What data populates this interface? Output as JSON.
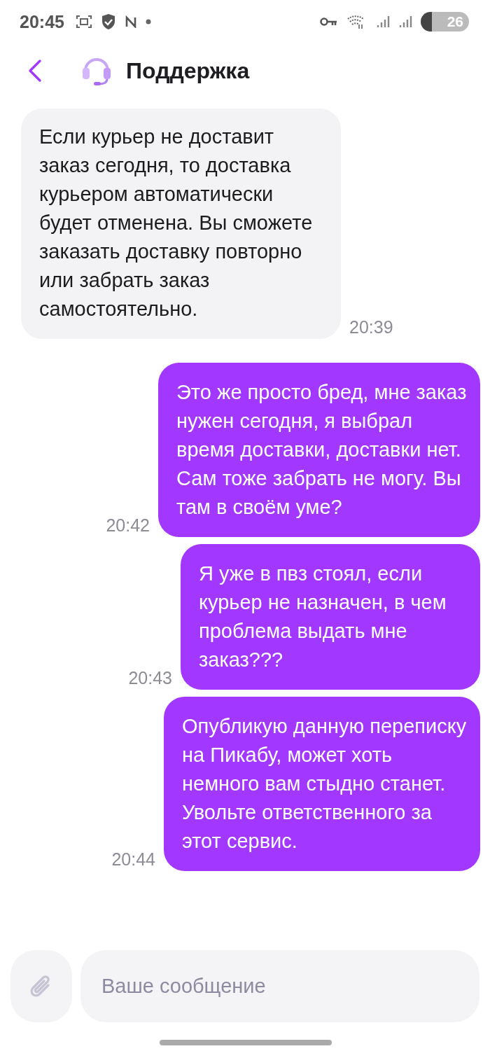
{
  "status_bar": {
    "time": "20:45",
    "battery": "26"
  },
  "header": {
    "title": "Поддержка"
  },
  "messages": [
    {
      "kind": "incoming",
      "text": "Если курьер не доставит заказ сегодня, то доставка курьером автоматически будет отменена. Вы сможете заказать доставку повторно или забрать заказ самостоятельно.",
      "time": "20:39"
    },
    {
      "kind": "outgoing",
      "text": "Это же просто бред, мне заказ нужен сегодня, я выбрал время доставки, доставки нет. Сам тоже забрать не могу. Вы там в своём уме?",
      "time": "20:42"
    },
    {
      "kind": "outgoing",
      "text": "Я уже в пвз стоял, если курьер не назначен, в чем проблема выдать мне заказ???",
      "time": "20:43"
    },
    {
      "kind": "outgoing",
      "text": "Опубликую данную переписку на Пикабу, может хоть немного вам стыдно станет. Увольте ответственного за этот сервис.",
      "time": "20:44"
    }
  ],
  "composer": {
    "placeholder": "Ваше сообщение"
  }
}
